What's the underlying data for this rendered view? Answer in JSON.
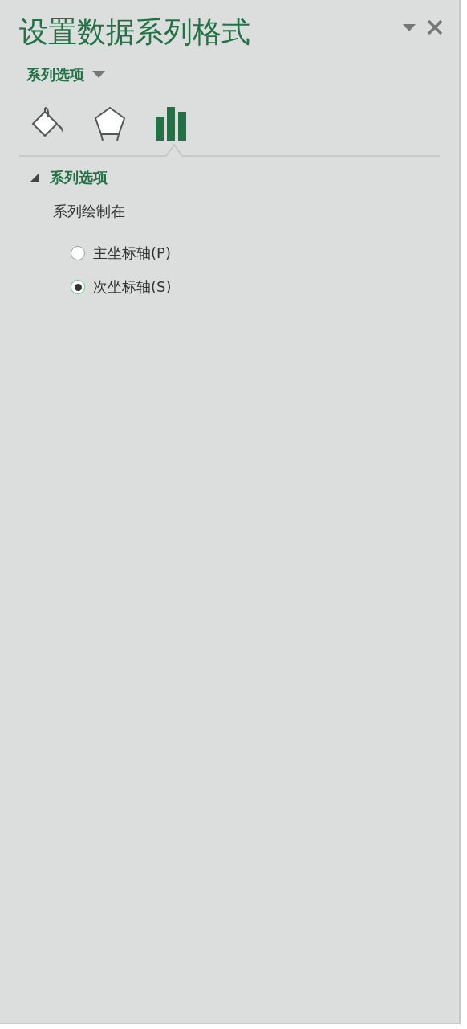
{
  "pane": {
    "title": "设置数据系列格式",
    "options_menu": "系列选项"
  },
  "tabs": [
    {
      "kind": "fill",
      "selected": false
    },
    {
      "kind": "effects",
      "selected": false
    },
    {
      "kind": "series",
      "selected": true
    }
  ],
  "section": {
    "title": "系列选项",
    "expanded": true,
    "label": "系列绘制在",
    "radios": [
      {
        "label": "主坐标轴(P)",
        "selected": false
      },
      {
        "label": "次坐标轴(S)",
        "selected": true
      }
    ]
  }
}
